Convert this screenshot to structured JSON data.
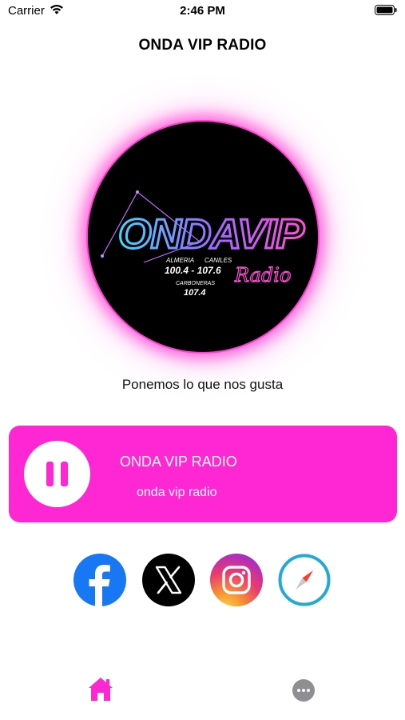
{
  "status_bar": {
    "carrier": "Carrier",
    "time": "2:46 PM"
  },
  "header": {
    "title": "ONDA VIP RADIO"
  },
  "logo": {
    "icon": "onda-vip-radio-logo",
    "wordmark": "ONDAVIP",
    "script": "Radio",
    "lines": [
      "ALMERIA",
      "CANILES",
      "100.4 - 107.6",
      "CARBONERAS",
      "107.4"
    ]
  },
  "tagline": "Ponemos lo que nos gusta",
  "player": {
    "title": "ONDA VIP RADIO",
    "subtitle": "onda vip radio",
    "state_icon": "pause-icon",
    "accent_color": "#ff26d4"
  },
  "social": [
    {
      "icon": "facebook-icon"
    },
    {
      "icon": "x-icon"
    },
    {
      "icon": "instagram-icon"
    },
    {
      "icon": "safari-compass-icon"
    }
  ],
  "tab_bar": {
    "items": [
      {
        "icon": "home-icon",
        "active": true
      },
      {
        "icon": "more-icon",
        "active": false
      }
    ]
  }
}
